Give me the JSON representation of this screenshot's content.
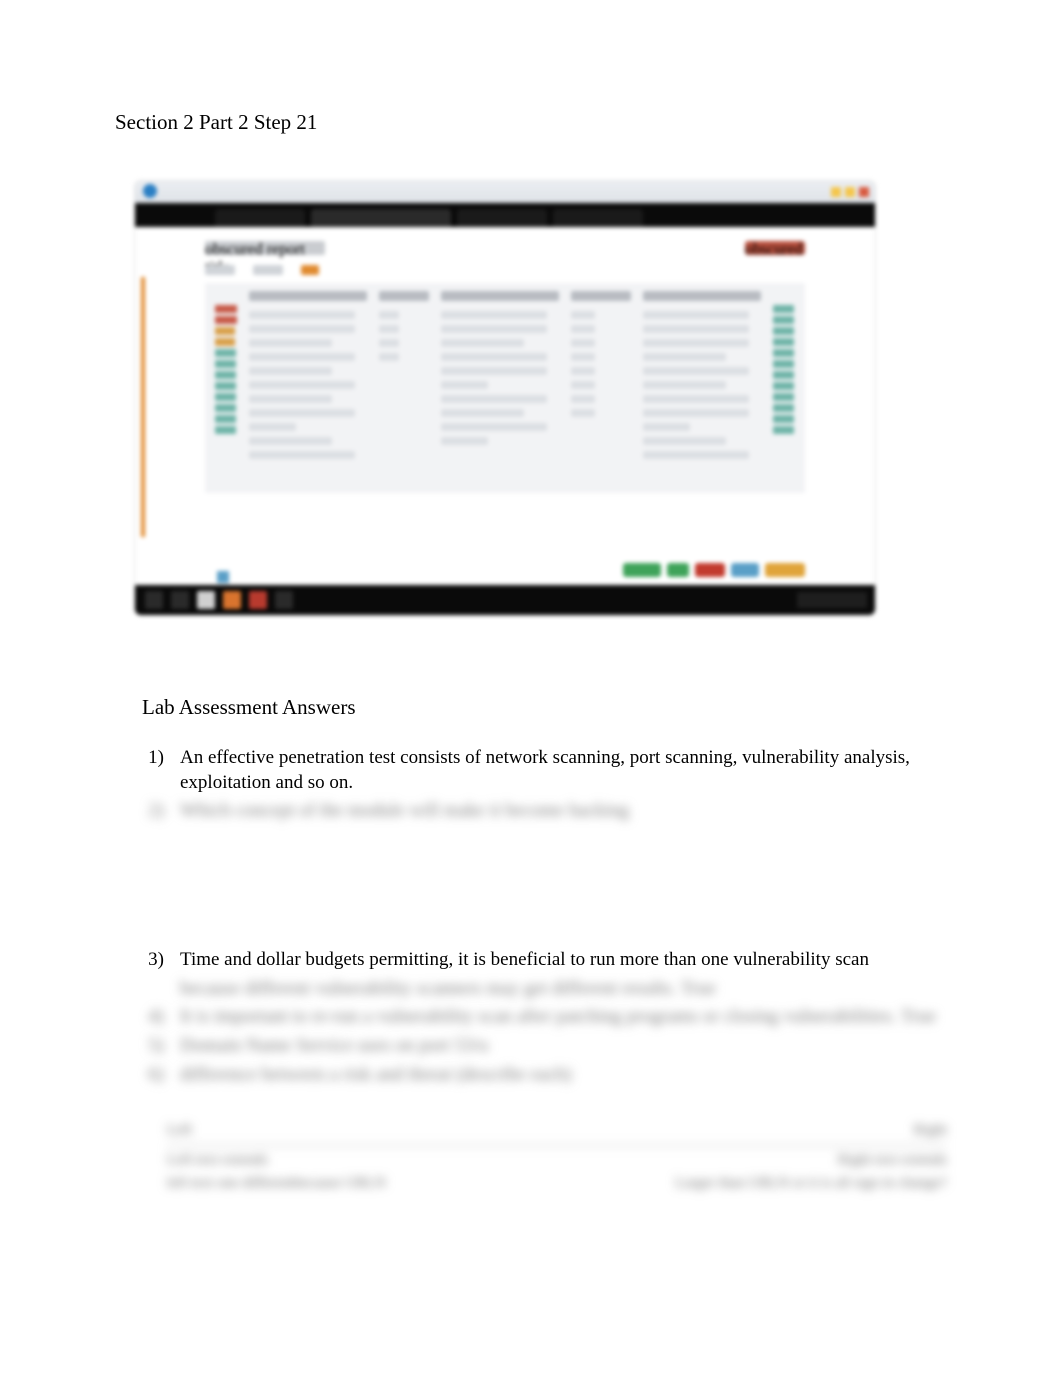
{
  "section_title": "Section 2 Part 2 Step 21",
  "assessment_title": "Lab Assessment Answers",
  "questions": [
    {
      "num": "1)",
      "text": "An effective penetration test consists of network scanning, port scanning, vulnerability analysis, exploitation and so on.",
      "blurred": false
    },
    {
      "num": "2)",
      "text": "Which concept of the module will make it become hacking",
      "blurred": true
    },
    {
      "num": "3)",
      "text": "Time and dollar budgets permitting, it is beneficial to run more than one vulnerability scan",
      "blurred": false
    },
    {
      "num": "",
      "text": "because different vulnerability scanners may get different results. True",
      "blurred": true
    },
    {
      "num": "4)",
      "text": "It is important to re-run a vulnerability scan after patching programs or closing vulnerabilities. True",
      "blurred": true
    },
    {
      "num": "5)",
      "text": "Domain Name Service uses on port 53/u",
      "blurred": true
    },
    {
      "num": "6)",
      "text": "difference between a risk and threat (describe each)",
      "blurred": true
    }
  ],
  "footer": {
    "left_top": "Left",
    "right_top": "Right",
    "left_mid": "Left text extends",
    "right_mid": "Right text extends",
    "left_bot": "left text one differentbecause URLN",
    "right_bot": "Larger than URLN or it is all sign in change?"
  },
  "screenshot": {
    "heading": "obscured report title",
    "action_label": "obscured",
    "tabs": [
      "tab",
      "tab",
      "tab",
      "tab"
    ],
    "buttons": [
      "green",
      "green",
      "red",
      "blue",
      "yellow"
    ]
  }
}
